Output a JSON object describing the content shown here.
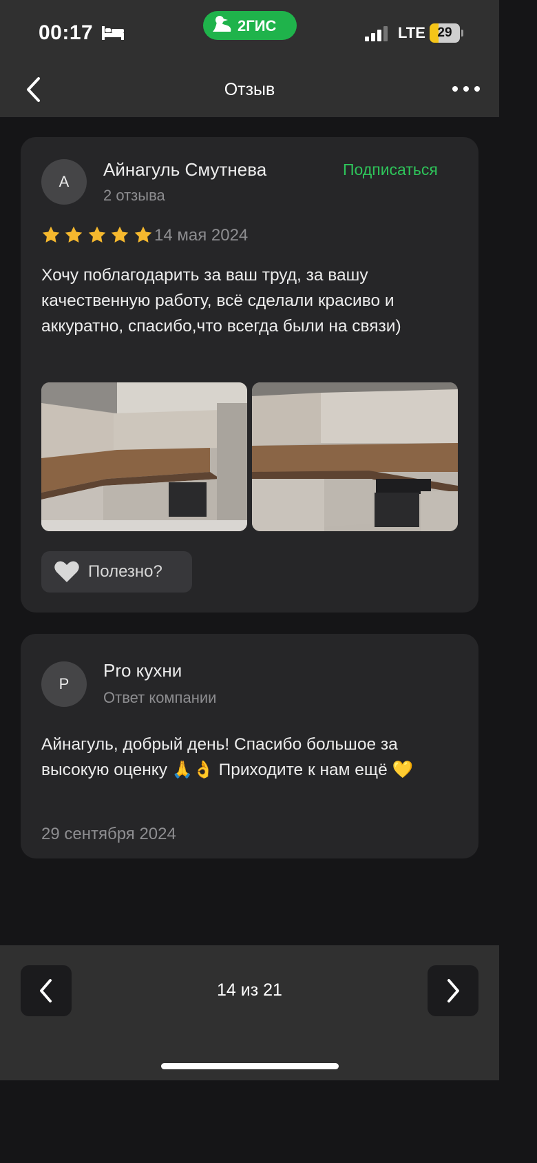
{
  "status_bar": {
    "time": "00:17",
    "brand": "2ГИС",
    "network": "LTE",
    "battery": "29",
    "icons": [
      "bed-icon",
      "duck-logo-icon",
      "signal-icon",
      "battery-icon"
    ]
  },
  "header": {
    "title": "Отзыв",
    "icons": [
      "chevron-left-icon",
      "more-dots-icon"
    ]
  },
  "review": {
    "avatar_letter": "А",
    "author": "Айнагуль Смутнева",
    "author_reviews": "2 отзыва",
    "subscribe_label": "Подписаться",
    "rating": 5,
    "date": "14 мая 2024",
    "text": "Хочу поблагодарить за ваш труд, за вашу качественную работу, всё сделали красиво и аккуратно, спасибо,что всегда были на связи)",
    "useful_label": "Полезно?",
    "photos_count": 2
  },
  "reply": {
    "avatar_letter": "P",
    "company": "Pro кухни",
    "role": "Ответ компании",
    "text": "Айнагуль, добрый день! Спасибо большое за высокую оценку 🙏👌 Приходите к нам ещё 💛",
    "date": "29 сентября 2024"
  },
  "pager": {
    "label": "14 из 21"
  },
  "colors": {
    "background": "#151517",
    "card": "#262628",
    "bars": "#303030",
    "accent_green": "#2ec45a",
    "star": "#f5b82e",
    "muted_text": "#8d8d90"
  }
}
